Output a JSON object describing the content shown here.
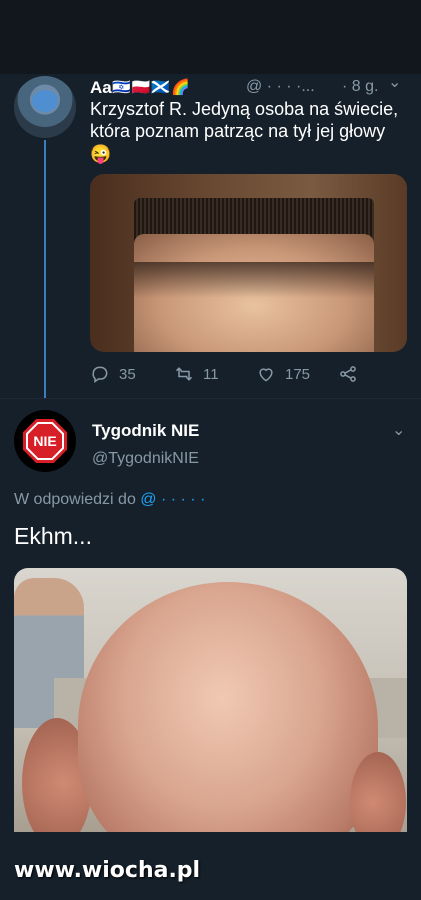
{
  "tweet1": {
    "author_name": "Aa",
    "flags": "🇮🇱🇵🇱🏴󠁧󠁢󠁳󠁣󠁴󠁿🌈",
    "handle": "@ · · · ·...",
    "time": "· 8 g.",
    "text": "Krzysztof R. Jedyną osoba na świecie, która poznam patrząc na tył jej głowy",
    "emoji_inline": "😎",
    "emoji_line2": "😜",
    "actions": {
      "replies": "35",
      "retweets": "11",
      "likes": "175"
    }
  },
  "tweet2": {
    "author_name": "Tygodnik NIE",
    "handle": "@TygodnikNIE",
    "avatar_text": "NIE",
    "reply_prefix": "W odpowiedzi do",
    "reply_mention": "@ · · · · ·",
    "text": "Ekhm..."
  },
  "watermark": "www.wiocha.pl",
  "colors": {
    "background": "#15202b",
    "accent": "#1da1f2",
    "muted": "#8899a6",
    "nie_red": "#d61f26"
  }
}
